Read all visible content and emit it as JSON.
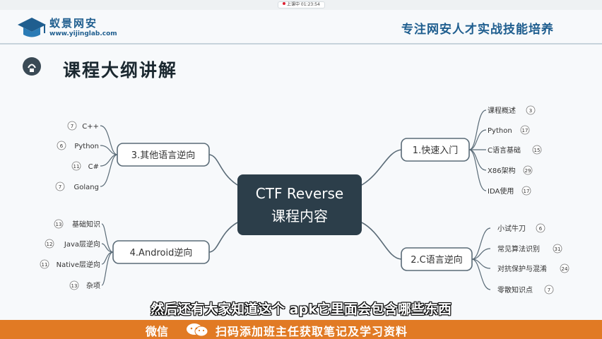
{
  "topbar": {
    "recording_label": "上课中 01:23:54"
  },
  "header": {
    "brand": "蚁景网安",
    "site": "www.yijinglab.com",
    "slogan": "专注网安人才实战技能培养"
  },
  "page": {
    "title": "课程大纲讲解"
  },
  "mindmap": {
    "center": {
      "line1": "CTF Reverse",
      "line2": "课程内容"
    },
    "branches": [
      {
        "label": "1.快速入门",
        "items": [
          {
            "label": "课程概述",
            "count": "3"
          },
          {
            "label": "Python",
            "count": "17"
          },
          {
            "label": "C语言基础",
            "count": "15"
          },
          {
            "label": "X86架构",
            "count": "29"
          },
          {
            "label": "IDA使用",
            "count": "17"
          }
        ]
      },
      {
        "label": "2.C语言逆向",
        "items": [
          {
            "label": "小试牛刀",
            "count": "6"
          },
          {
            "label": "常见算法识别",
            "count": "31"
          },
          {
            "label": "对抗保护与混淆",
            "count": "24"
          },
          {
            "label": "零散知识点",
            "count": "7"
          }
        ]
      },
      {
        "label": "3.其他语言逆向",
        "items": [
          {
            "label": "C++",
            "count": "7"
          },
          {
            "label": "Python",
            "count": "6"
          },
          {
            "label": "C#",
            "count": "11"
          },
          {
            "label": "Golang",
            "count": "7"
          }
        ]
      },
      {
        "label": "4.Android逆向",
        "items": [
          {
            "label": "基础知识",
            "count": "13"
          },
          {
            "label": "Java层逆向",
            "count": "12"
          },
          {
            "label": "Native层逆向",
            "count": "11"
          },
          {
            "label": "杂项",
            "count": "13"
          }
        ]
      }
    ]
  },
  "subtitle": "然后还有大家知道这个 apk它里面会包含哪些东西",
  "footer": {
    "wechat_label": "微信",
    "ad_text": "扫码添加班主任获取笔记及学习资料"
  },
  "colors": {
    "brand": "#1f5e8f",
    "center_fill": "#2c3e4a",
    "node_border": "#5a6b77",
    "footer": "#e17a24"
  }
}
